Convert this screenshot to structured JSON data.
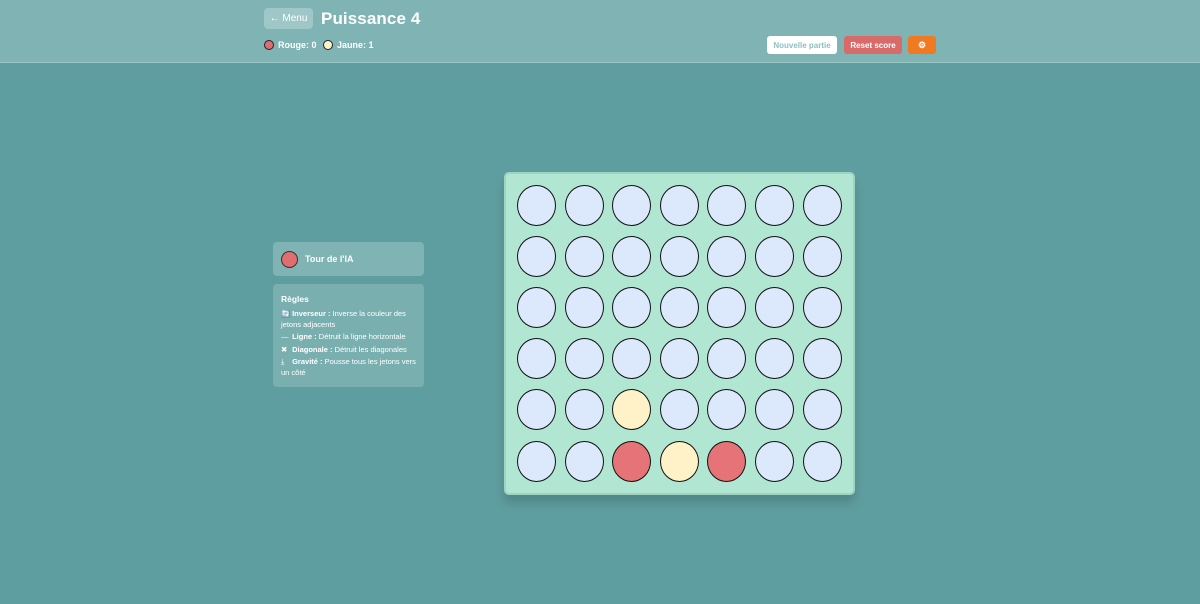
{
  "header": {
    "menu_label": "← Menu",
    "title": "Puissance 4",
    "scores": [
      {
        "label": "Rouge: 0",
        "color": "#e06d70"
      },
      {
        "label": "Jaune: 1",
        "color": "#fff1c8"
      }
    ],
    "new_game_label": "Nouvelle partie",
    "reset_label": "Reset score",
    "settings_icon": "gear-icon",
    "settings_glyph": "⚙"
  },
  "turn": {
    "label": "Tour de l'IA",
    "color": "#e06d70"
  },
  "rules": {
    "title": "Règles",
    "items": [
      {
        "icon": "🔄",
        "icon_name": "swap-icon",
        "name": "Inverseur :",
        "desc": "Inverse la couleur des jetons adjacents"
      },
      {
        "icon": "—",
        "icon_name": "line-icon",
        "name": "Ligne :",
        "desc": "Détruit la ligne horizontale"
      },
      {
        "icon": "✖",
        "icon_name": "cross-icon",
        "name": "Diagonale :",
        "desc": "Détruit les diagonales"
      },
      {
        "icon": "⤓",
        "icon_name": "gravity-icon",
        "name": "Gravité :",
        "desc": "Pousse tous les jetons vers un côté"
      }
    ]
  },
  "board": {
    "rows": 6,
    "cols": 7,
    "cells": [
      [
        "",
        "",
        "",
        "",
        "",
        "",
        ""
      ],
      [
        "",
        "",
        "",
        "",
        "",
        "",
        ""
      ],
      [
        "",
        "",
        "",
        "",
        "",
        "",
        ""
      ],
      [
        "",
        "",
        "",
        "",
        "",
        "",
        ""
      ],
      [
        "",
        "",
        "Y",
        "",
        "",
        "",
        ""
      ],
      [
        "",
        "",
        "R",
        "Y",
        "R",
        "",
        ""
      ]
    ],
    "colors": {
      "empty": "#dce8fb",
      "R": "#e57377",
      "Y": "#fff1c8"
    }
  }
}
